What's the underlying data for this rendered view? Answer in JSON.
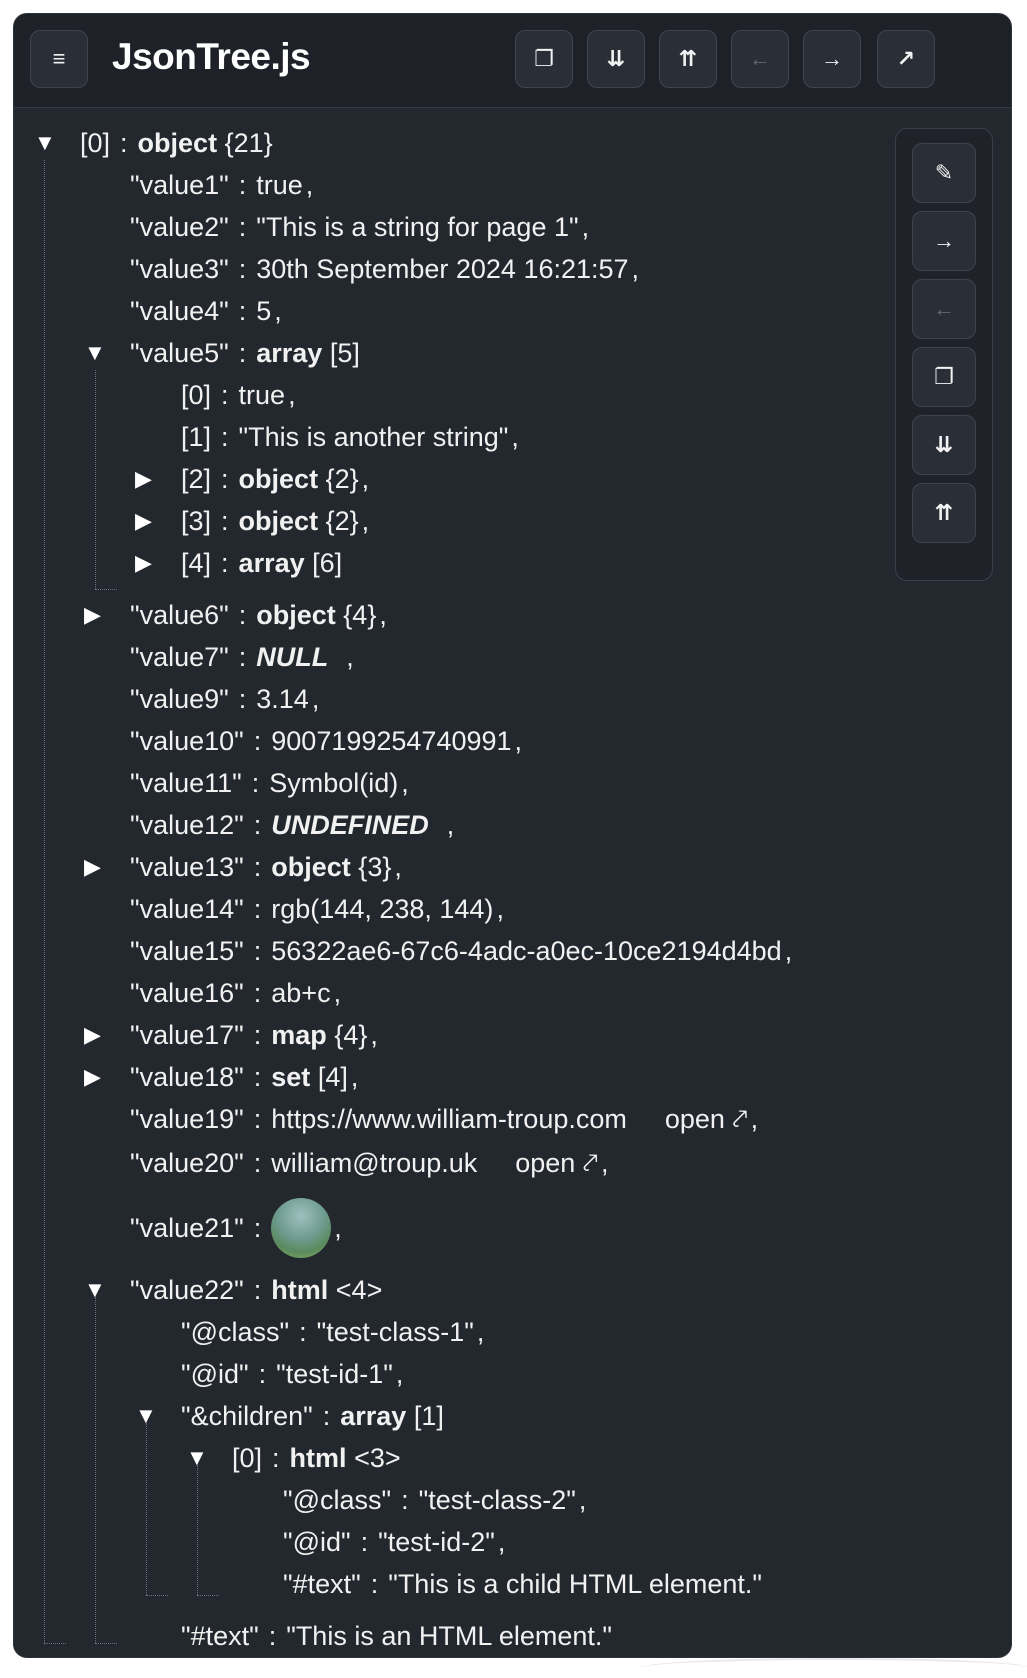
{
  "app": {
    "title": "JsonTree.js"
  },
  "toolbar": {
    "menu_icon": "≡",
    "copy_icon": "❐",
    "expand_icon": "⇊",
    "collapse_icon": "⇈",
    "back_icon": "←",
    "forward_icon": "→",
    "popout_icon": "↗"
  },
  "side": {
    "edit_icon": "✎",
    "next_icon": "→",
    "prev_icon": "←",
    "copy_icon": "❐",
    "expand_icon": "⇊",
    "collapse_icon": "⇈"
  },
  "tree": {
    "root": {
      "key": "[0]",
      "type": "object",
      "count": "{21}"
    },
    "rows": [
      {
        "key": "\"value1\"",
        "value": "true"
      },
      {
        "key": "\"value2\"",
        "value": "\"This is a string for page 1\""
      },
      {
        "key": "\"value3\"",
        "value": "30th September 2024 16:21:57"
      },
      {
        "key": "\"value4\"",
        "value": "5"
      },
      {
        "key": "\"value5\"",
        "type": "array",
        "count": "[5]"
      },
      {
        "key": "[0]",
        "value": "true"
      },
      {
        "key": "[1]",
        "value": "\"This is another string\""
      },
      {
        "key": "[2]",
        "type": "object",
        "count": "{2}"
      },
      {
        "key": "[3]",
        "type": "object",
        "count": "{2}"
      },
      {
        "key": "[4]",
        "type": "array",
        "count": "[6]"
      },
      {
        "key": "\"value6\"",
        "type": "object",
        "count": "{4}"
      },
      {
        "key": "\"value7\"",
        "value": "NULL"
      },
      {
        "key": "\"value9\"",
        "value": "3.14"
      },
      {
        "key": "\"value10\"",
        "value": "9007199254740991"
      },
      {
        "key": "\"value11\"",
        "value": "Symbol(id)"
      },
      {
        "key": "\"value12\"",
        "value": "UNDEFINED"
      },
      {
        "key": "\"value13\"",
        "type": "object",
        "count": "{3}"
      },
      {
        "key": "\"value14\"",
        "value": "rgb(144, 238, 144)"
      },
      {
        "key": "\"value15\"",
        "value": "56322ae6-67c6-4adc-a0ec-10ce2194d4bd"
      },
      {
        "key": "\"value16\"",
        "value": "ab+c"
      },
      {
        "key": "\"value17\"",
        "type": "map",
        "count": "{4}"
      },
      {
        "key": "\"value18\"",
        "type": "set",
        "count": "[4]"
      },
      {
        "key": "\"value19\"",
        "value": "https://www.william-troup.com",
        "open": "open ⤤"
      },
      {
        "key": "\"value20\"",
        "value": "william@troup.uk",
        "open": "open ⤤"
      },
      {
        "key": "\"value21\""
      },
      {
        "key": "\"value22\"",
        "type": "html",
        "count": "<4>"
      },
      {
        "key": "\"@class\"",
        "value": "\"test-class-1\""
      },
      {
        "key": "\"@id\"",
        "value": "\"test-id-1\""
      },
      {
        "key": "\"&children\"",
        "type": "array",
        "count": "[1]"
      },
      {
        "key": "[0]",
        "type": "html",
        "count": "<3>"
      },
      {
        "key": "\"@class\"",
        "value": "\"test-class-2\""
      },
      {
        "key": "\"@id\"",
        "value": "\"test-id-2\""
      },
      {
        "key": "\"#text\"",
        "value": "\"This is a child HTML element.\""
      },
      {
        "key": "\"#text\"",
        "value": "\"This is an HTML element.\""
      }
    ],
    "sep": ":",
    "comma": ","
  }
}
